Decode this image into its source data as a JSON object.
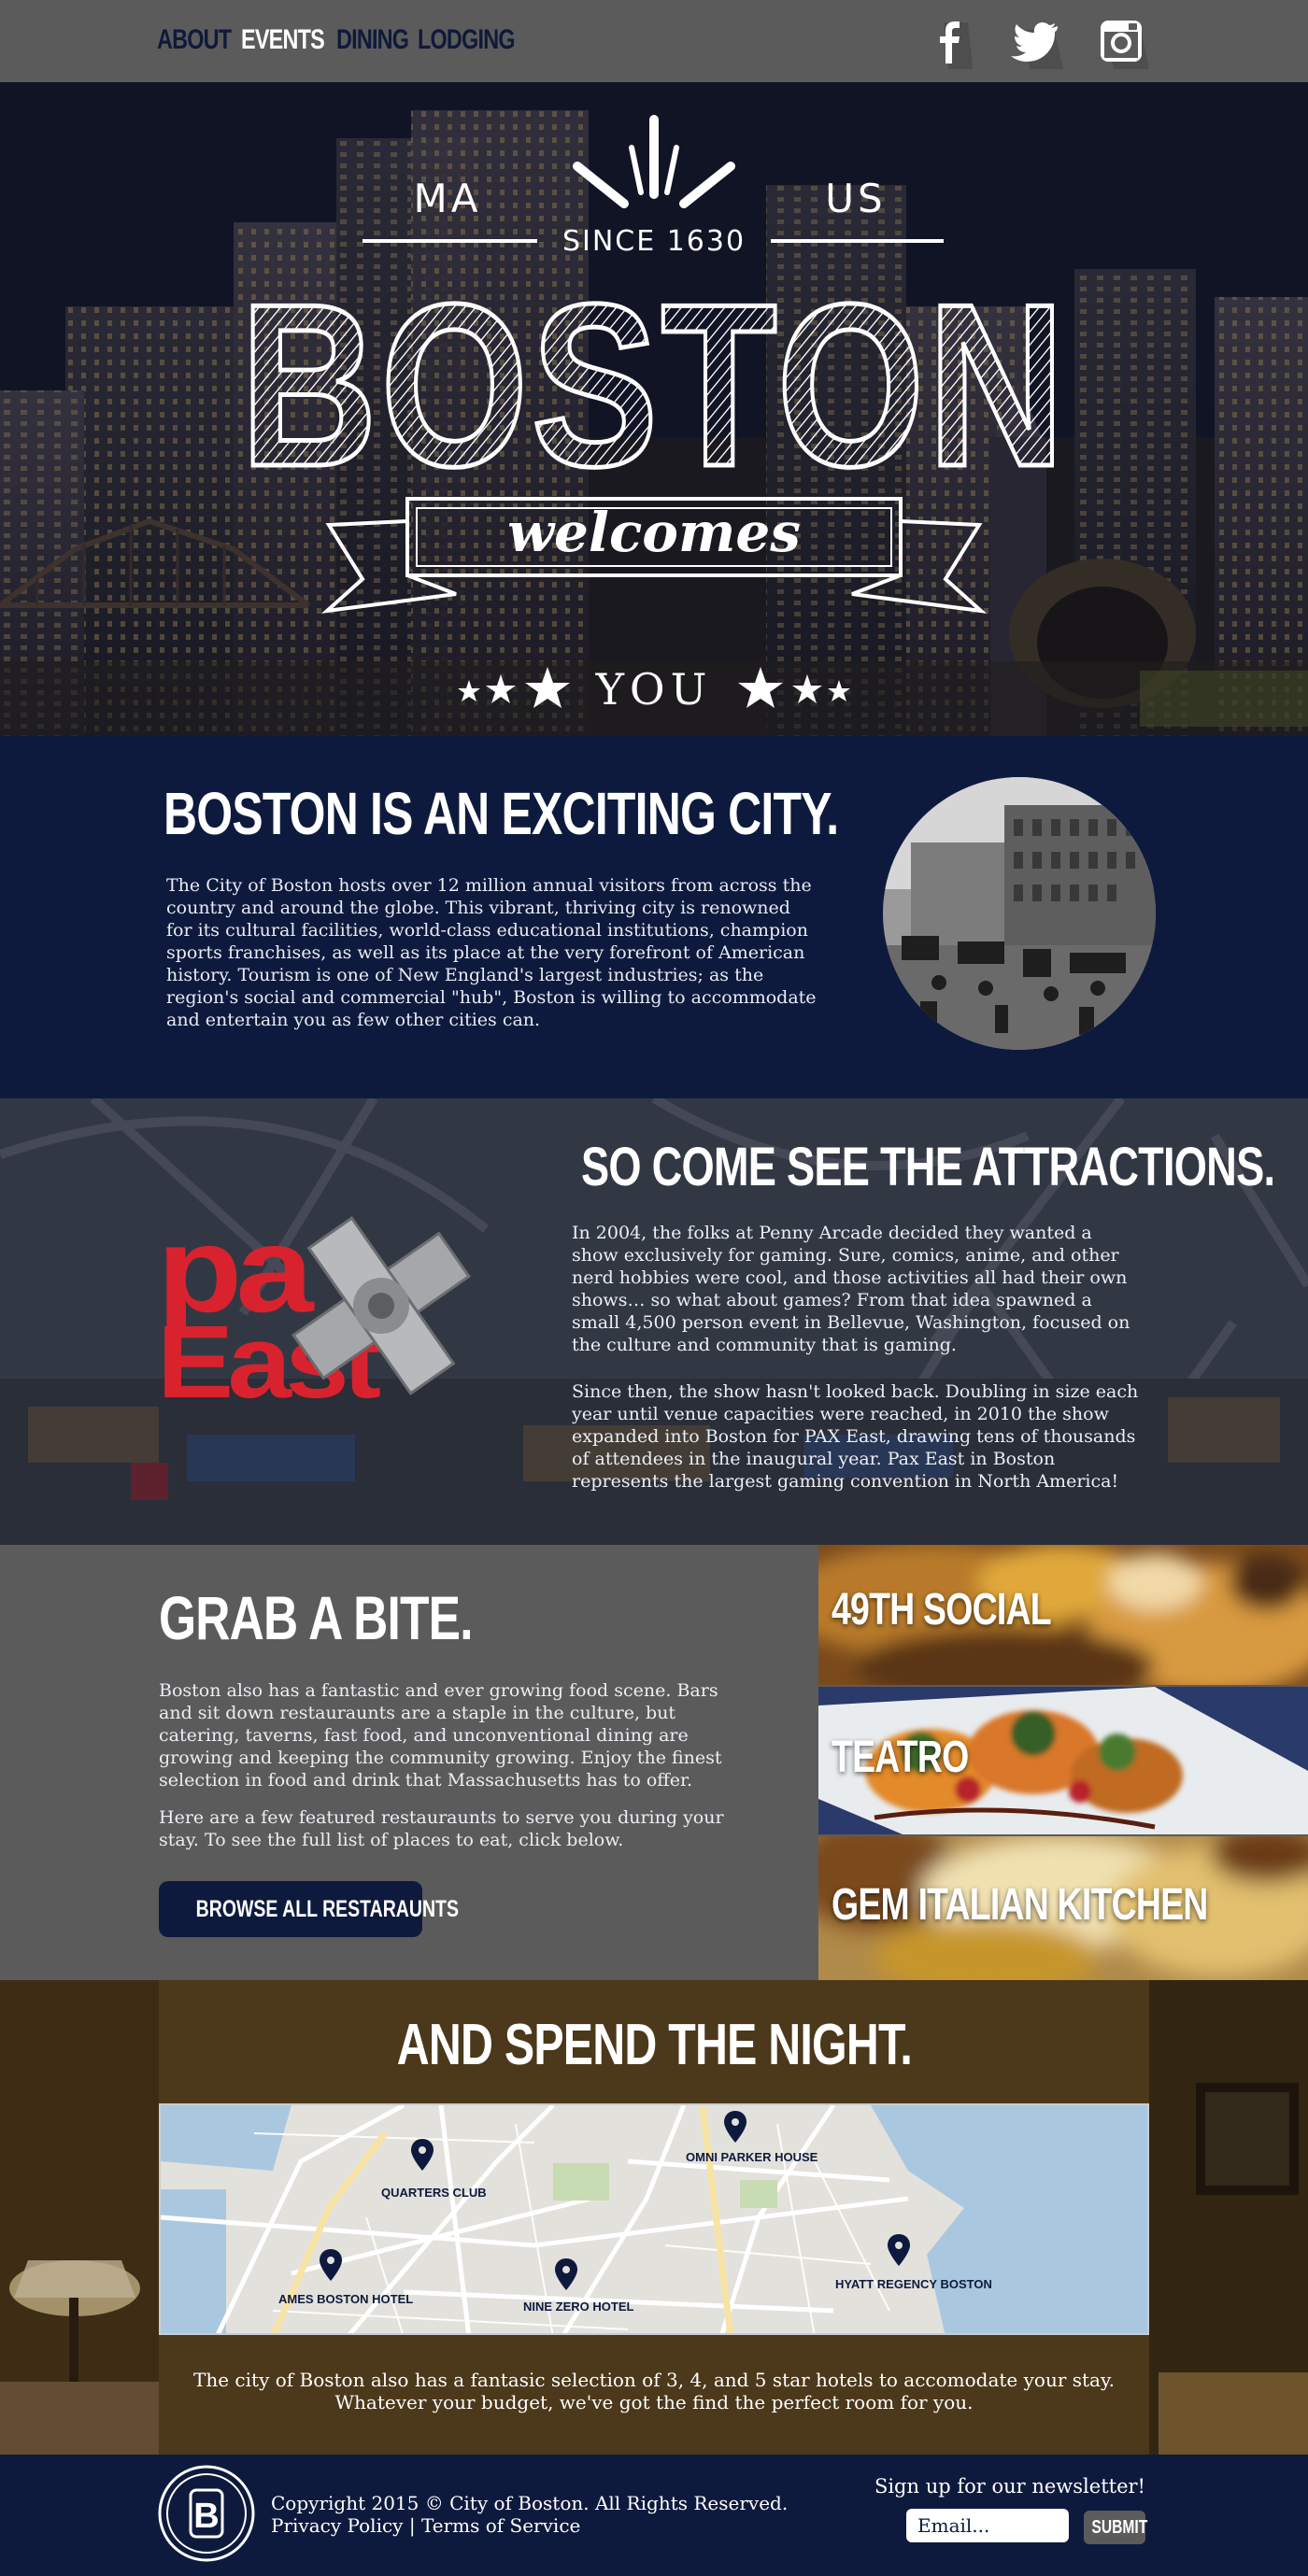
{
  "nav": {
    "links": [
      "ABOUT",
      "EVENTS",
      "DINING",
      "LODGING"
    ],
    "active": "EVENTS",
    "social_icons": [
      "facebook-icon",
      "twitter-icon",
      "instagram-icon"
    ]
  },
  "hero": {
    "left_word": "MA",
    "right_word": "US",
    "since": "SINCE 1630",
    "city": "BOSTON",
    "banner": "welcomes",
    "you": "YOU"
  },
  "intro": {
    "title": "BOSTON IS AN EXCITING CITY.",
    "body": "The City of Boston hosts over 12 million annual visitors from across the country and around the globe. This vibrant, thriving city is renowned for its cultural facilities, world-class educational institutions, champion sports franchises, as well as its place at the very forefront of American history. Tourism is one of New England's largest industries; as the region's social and commercial \"hub\", Boston is willing to accommodate and entertain you as few other cities can."
  },
  "attractions": {
    "title": "SO COME SEE THE ATTRACTIONS.",
    "logo_text_1": "pa",
    "logo_text_2": "East",
    "p1": "In 2004, the folks at Penny Arcade decided they wanted a show exclusively for gaming. Sure, comics, anime, and other nerd hobbies were cool, and those activities all had their own shows… so what about games? From that idea spawned a small 4,500 person event in Bellevue, Washington, focused on the culture and community that is gaming.",
    "p2": "Since then, the show hasn't looked back. Doubling in size each year until venue capacities were reached, in 2010 the show expanded into Boston for PAX East, drawing tens of thousands of attendees in the inaugural year. Pax East in Boston represents the largest gaming convention in North America!"
  },
  "dining": {
    "title": "GRAB A BITE.",
    "p1": "Boston also has a fantastic and ever growing food scene. Bars and sit down restauraunts are a staple in the culture, but catering, taverns, fast food, and unconventional dining are growing  and keeping the community growing. Enjoy the finest selection in food and drink that Massachusetts has to offer.",
    "p2": "Here are a few featured restauraunts to serve you during your stay. To see the full list of places to eat, click below.",
    "button": "BROWSE ALL RESTARAUNTS",
    "restaurants": [
      "49TH SOCIAL",
      "TEATRO",
      "GEM ITALIAN KITCHEN"
    ]
  },
  "lodging": {
    "title": "AND SPEND THE NIGHT.",
    "hotels": [
      "QUARTERS CLUB",
      "OMNI PARKER HOUSE",
      "AMES BOSTON HOTEL",
      "NINE ZERO HOTEL",
      "HYATT REGENCY BOSTON"
    ],
    "body": "The city of Boston also has a fantasic selection of 3, 4, and 5 star hotels to accomodate your stay. Whatever your budget, we've got the find the perfect room for you."
  },
  "footer": {
    "seal_letter": "B",
    "copyright": "Copyright 2015 © City of Boston. All Rights Reserved.",
    "privacy": "Privacy Policy",
    "separator": "|",
    "terms": "Terms of Service",
    "newsletter": "Sign up for our newsletter!",
    "email_placeholder": "Email...",
    "submit": "SUBMIT"
  }
}
